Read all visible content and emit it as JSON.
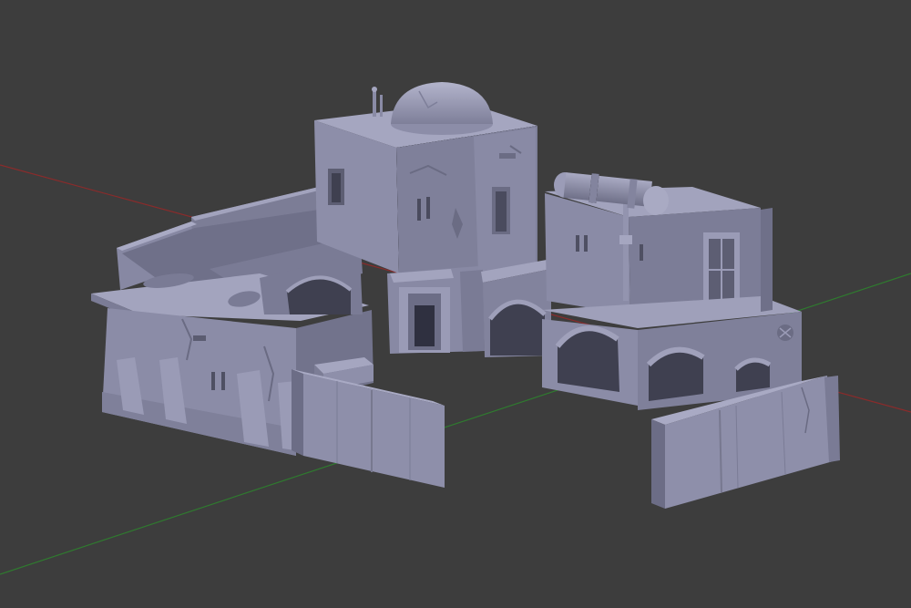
{
  "viewport": {
    "background": "#3d3d3d",
    "x_axis_color": "#8a2b2b",
    "y_axis_color": "#2f7a2f",
    "model_color": "#8f90ad",
    "model_light": "#a6a7c2",
    "model_dark": "#6c6d86",
    "model_shadow": "#555668"
  }
}
